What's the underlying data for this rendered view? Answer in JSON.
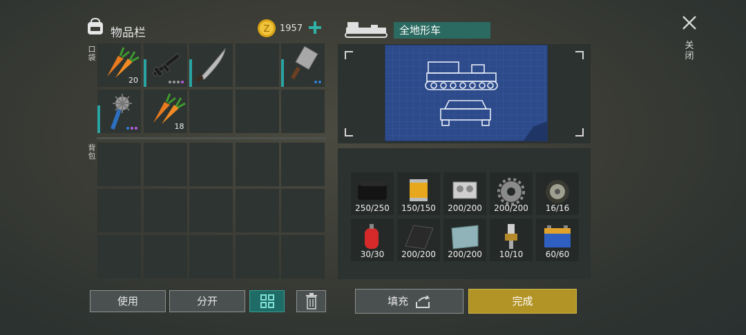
{
  "inventory": {
    "title": "物品栏",
    "coins": "1957",
    "pocket_label": "口袋",
    "backpack_label": "背包",
    "pocket_slots": [
      {
        "item": "carrot-icon",
        "count": "20",
        "dots": []
      },
      {
        "item": "rifle-icon",
        "count": "",
        "dots": [
          "#9a9a9a",
          "#9a9a9a",
          "#9a9a9a",
          "#b45ce0"
        ]
      },
      {
        "item": "machete-icon",
        "count": "",
        "dots": []
      },
      {
        "item": "",
        "count": "",
        "dots": []
      },
      {
        "item": "cleaver-icon",
        "count": "",
        "dots": [
          "#2f7fd8",
          "#2f7fd8"
        ]
      },
      {
        "item": "spiked-mace-icon",
        "count": "",
        "dots": [
          "#2f7fd8",
          "#b45ce0",
          "#b45ce0"
        ]
      },
      {
        "item": "carrot-icon",
        "count": "18",
        "dots": []
      },
      {
        "item": "",
        "count": "",
        "dots": []
      },
      {
        "item": "",
        "count": "",
        "dots": []
      },
      {
        "item": "",
        "count": "",
        "dots": []
      }
    ]
  },
  "crafting": {
    "vehicle_name": "全地形车",
    "resources": [
      {
        "item": "rubber-icon",
        "count": "250/250"
      },
      {
        "item": "filter-icon",
        "count": "150/150"
      },
      {
        "item": "engine-block-icon",
        "count": "200/200"
      },
      {
        "item": "gear-icon",
        "count": "200/200"
      },
      {
        "item": "wheel-icon",
        "count": "16/16"
      },
      {
        "item": "gas-canister-icon",
        "count": "30/30"
      },
      {
        "item": "carbon-sheet-icon",
        "count": "200/200"
      },
      {
        "item": "metal-plate-icon",
        "count": "200/200"
      },
      {
        "item": "spark-plug-icon",
        "count": "10/10"
      },
      {
        "item": "battery-icon",
        "count": "60/60"
      }
    ]
  },
  "buttons": {
    "use": "使用",
    "split": "分开",
    "fill": "填充",
    "done": "完成"
  },
  "close_label": "关闭",
  "colors": {
    "accent_teal": "#1f6c66",
    "done_gold": "#b29325",
    "blueprint_blue": "#2d4a8a"
  }
}
